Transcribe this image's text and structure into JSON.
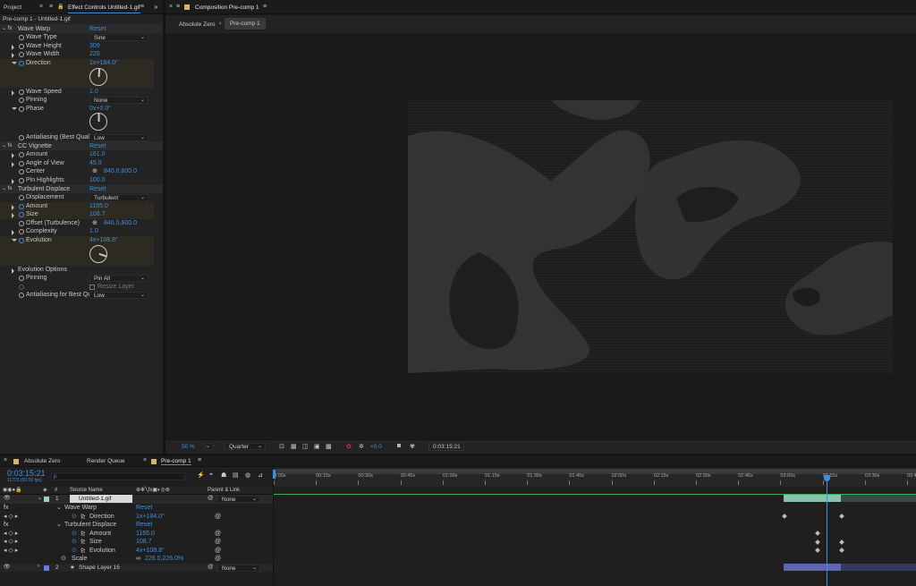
{
  "top_left_panel": {
    "project_tab": "Project",
    "effect_controls_tab": "Effect Controls Untitled-1.gif",
    "breadcrumb": "Pre-comp 1 - Untitled-1.gif",
    "overflow": "»"
  },
  "effects": {
    "wave_warp": {
      "name": "Wave Warp",
      "reset": "Reset",
      "wave_type_label": "Wave Type",
      "wave_type": "Sine",
      "wave_height_label": "Wave Height",
      "wave_height": "309",
      "wave_width_label": "Wave Width",
      "wave_width": "220",
      "direction_label": "Direction",
      "direction": "1x+184.0°",
      "wave_speed_label": "Wave Speed",
      "wave_speed": "1.0",
      "pinning_label": "Pinning",
      "pinning": "None",
      "phase_label": "Phase",
      "phase": "0x+0.0°",
      "antialiasing_label": "Antialiasing (Best Quality)",
      "antialiasing": "Low"
    },
    "cc_vignette": {
      "name": "CC Vignette",
      "reset": "Reset",
      "amount_label": "Amount",
      "amount": "161.0",
      "angle_label": "Angle of View",
      "angle": "45.0",
      "center_label": "Center",
      "center": "840.0,600.0",
      "pin_label": "Pin Highlights",
      "pin": "100.0"
    },
    "turbulent_displace": {
      "name": "Turbulent Displace",
      "reset": "Reset",
      "displacement_label": "Displacement",
      "displacement": "Turbulent",
      "amount_label": "Amount",
      "amount": "1165.0",
      "size_label": "Size",
      "size": "108.7",
      "offset_label": "Offset (Turbulence)",
      "offset": "840.0,600.0",
      "complexity_label": "Complexity",
      "complexity": "1.0",
      "evolution_label": "Evolution",
      "evolution": "4x+108.8°",
      "evolution_options_label": "Evolution Options",
      "pinning_label": "Pinning",
      "pinning": "Pin All",
      "resize_label": "Resize Layer",
      "antialiasing_label": "Antialiasing for Best Quality",
      "antialiasing": "Low"
    }
  },
  "composition": {
    "tab": "Composition Pre-comp 1",
    "flow_left": "Absolute Zero",
    "flow_current": "Pre-comp 1",
    "zoom": "50 %",
    "resolution": "Quarter",
    "exposure": "+0.0",
    "timecode": "0:03:15:21"
  },
  "timeline": {
    "tabs": [
      "Absolute Zero",
      "Render Queue",
      "Pre-comp 1"
    ],
    "timecode": "0:03:15:21",
    "frame_info": "11723 (60.00 fps)",
    "search_placeholder": "ρ",
    "col_hash": "#",
    "col_source": "Source Name",
    "col_parent": "Parent & Link",
    "ruler": [
      "0:00s",
      "00:15s",
      "00:30s",
      "00:45s",
      "01:00s",
      "01:15s",
      "01:30s",
      "01:45s",
      "02:00s",
      "02:15s",
      "02:30s",
      "02:45s",
      "03:00s",
      "03:15s",
      "03:30s",
      "03:45"
    ],
    "layer1_num": "1",
    "layer1_name": "Untitled-1.gif",
    "layer1_parent": "None",
    "wave_warp": "Wave Warp",
    "reset1": "Reset",
    "direction_label": "Direction",
    "direction": "1x+184.0°",
    "turbulent": "Turbulent Displace",
    "reset2": "Reset",
    "amount_label": "Amount",
    "amount": "1165.0",
    "size_label": "Size",
    "size": "108.7",
    "evolution_label": "Evolution",
    "evolution": "4x+108.8°",
    "scale_label": "Scale",
    "scale": "226.0,226.0%",
    "layer2_num": "2",
    "layer2_name": "Shape Layer 16",
    "layer2_parent": "None"
  }
}
